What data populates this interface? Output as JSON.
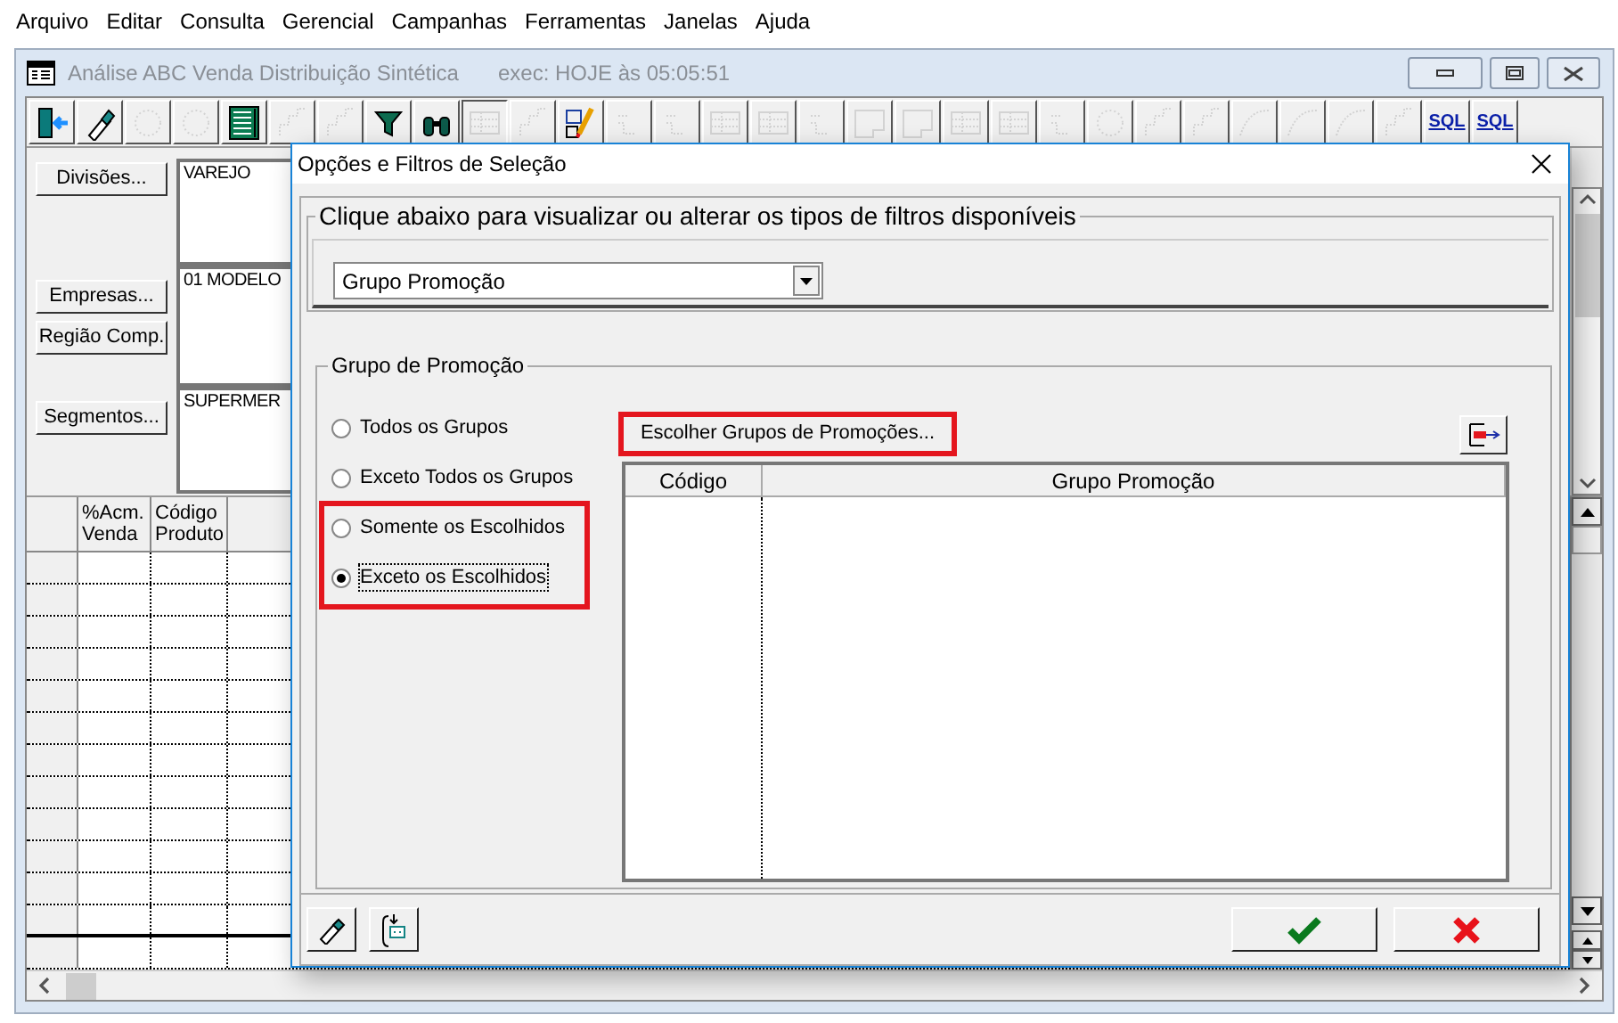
{
  "menu": [
    "Arquivo",
    "Editar",
    "Consulta",
    "Gerencial",
    "Campanhas",
    "Ferramentas",
    "Janelas",
    "Ajuda"
  ],
  "window": {
    "title": "Análise ABC Venda Distribuição Sintética",
    "exec": "exec: HOJE às 05:05:51"
  },
  "toolbar": [
    {
      "kind": "exit",
      "disabled": false,
      "pressed": false
    },
    {
      "kind": "eraser",
      "disabled": false,
      "pressed": false
    },
    {
      "kind": "ring",
      "disabled": true,
      "pressed": false
    },
    {
      "kind": "ring",
      "disabled": true,
      "pressed": false
    },
    {
      "kind": "columns",
      "disabled": false,
      "pressed": false
    },
    {
      "kind": "steps",
      "disabled": true,
      "pressed": false
    },
    {
      "kind": "steps",
      "disabled": true,
      "pressed": false
    },
    {
      "kind": "filter",
      "disabled": false,
      "pressed": false
    },
    {
      "kind": "binoculars",
      "disabled": false,
      "pressed": false
    },
    {
      "kind": "table",
      "disabled": true,
      "pressed": true
    },
    {
      "kind": "steps",
      "disabled": true,
      "pressed": false
    },
    {
      "kind": "edit",
      "disabled": false,
      "pressed": false
    },
    {
      "kind": "line",
      "disabled": true,
      "pressed": false
    },
    {
      "kind": "line",
      "disabled": true,
      "pressed": false
    },
    {
      "kind": "table",
      "disabled": true,
      "pressed": false
    },
    {
      "kind": "table",
      "disabled": true,
      "pressed": false
    },
    {
      "kind": "line",
      "disabled": true,
      "pressed": false
    },
    {
      "kind": "box",
      "disabled": true,
      "pressed": false
    },
    {
      "kind": "box",
      "disabled": true,
      "pressed": false
    },
    {
      "kind": "table",
      "disabled": true,
      "pressed": false
    },
    {
      "kind": "table",
      "disabled": true,
      "pressed": false
    },
    {
      "kind": "line",
      "disabled": true,
      "pressed": false
    },
    {
      "kind": "ring",
      "disabled": true,
      "pressed": false
    },
    {
      "kind": "steps",
      "disabled": true,
      "pressed": false
    },
    {
      "kind": "steps",
      "disabled": true,
      "pressed": false
    },
    {
      "kind": "curve",
      "disabled": true,
      "pressed": false
    },
    {
      "kind": "curve",
      "disabled": true,
      "pressed": false
    },
    {
      "kind": "curve",
      "disabled": true,
      "pressed": false
    },
    {
      "kind": "steps",
      "disabled": true,
      "pressed": false
    },
    {
      "kind": "sql",
      "label": "SQL",
      "disabled": false,
      "pressed": false
    },
    {
      "kind": "sql",
      "label": "SQL",
      "disabled": false,
      "pressed": false
    }
  ],
  "filters": [
    {
      "button": "Divisões...",
      "value": "VAREJO"
    },
    {
      "button": "Empresas...",
      "button_2": "Região Comp.",
      "value": "01 MODELO"
    },
    {
      "button": "Segmentos...",
      "value": "SUPERMER"
    }
  ],
  "grid": {
    "columns": [
      "%Acm.\nVenda",
      "Código\nProduto"
    ]
  },
  "dialog": {
    "title": "Opções e Filtros de Seleção",
    "filter_group": {
      "legend": "Clique abaixo para visualizar ou alterar os tipos de filtros disponíveis",
      "value": "Grupo Promoção"
    },
    "promo_group": {
      "legend": "Grupo de Promoção",
      "options": [
        {
          "label": "Todos os Grupos",
          "selected": false
        },
        {
          "label": "Exceto Todos os Grupos",
          "selected": false
        },
        {
          "label": "Somente os Escolhidos",
          "selected": false
        },
        {
          "label": "Exceto os Escolhidos",
          "selected": true
        }
      ],
      "choose_button": "Escolher Grupos de Promoções...",
      "table": {
        "columns": [
          "Código",
          "Grupo Promoção"
        ]
      }
    }
  }
}
